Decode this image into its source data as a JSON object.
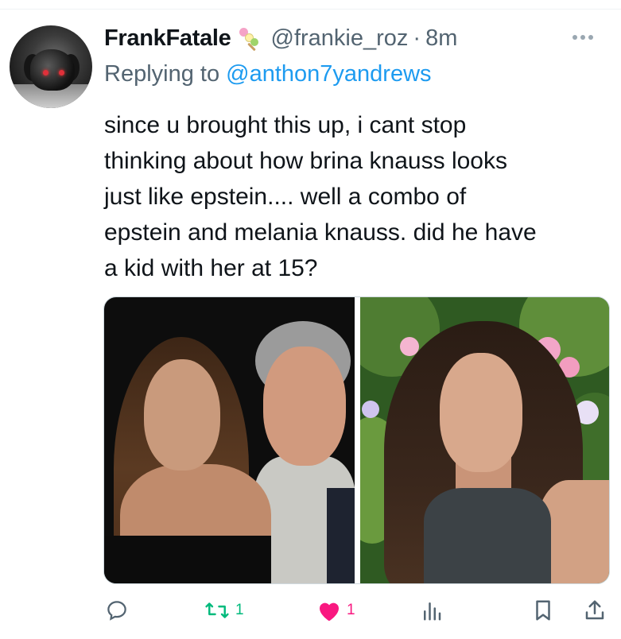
{
  "tweet": {
    "display_name": "FrankFatale",
    "handle": "@frankie_roz",
    "separator": "·",
    "time": "8m",
    "replying_prefix": "Replying to",
    "replying_to": "@anthon7yandrews",
    "text_lines": [
      "since u brought this up, i cant stop",
      "thinking about how brina knauss looks",
      "just like epstein.... well a combo of",
      "epstein and melania knauss. did he have",
      "a kid with her at 15?"
    ]
  },
  "media": {
    "photos": [
      "photo-left",
      "photo-right"
    ]
  },
  "actions": {
    "reply_count": "",
    "retweet_count": "1",
    "like_count": "1",
    "views_count": ""
  },
  "colors": {
    "text_primary": "#0f1419",
    "text_secondary": "#536471",
    "link": "#1d9bf0",
    "retweet_green": "#00ba7c",
    "like_pink": "#f91880",
    "icon_gray": "#536471"
  },
  "icons": [
    "reply-icon",
    "retweet-icon",
    "like-icon",
    "views-icon",
    "bookmark-icon",
    "share-icon",
    "more-icon",
    "emoji-icon"
  ]
}
